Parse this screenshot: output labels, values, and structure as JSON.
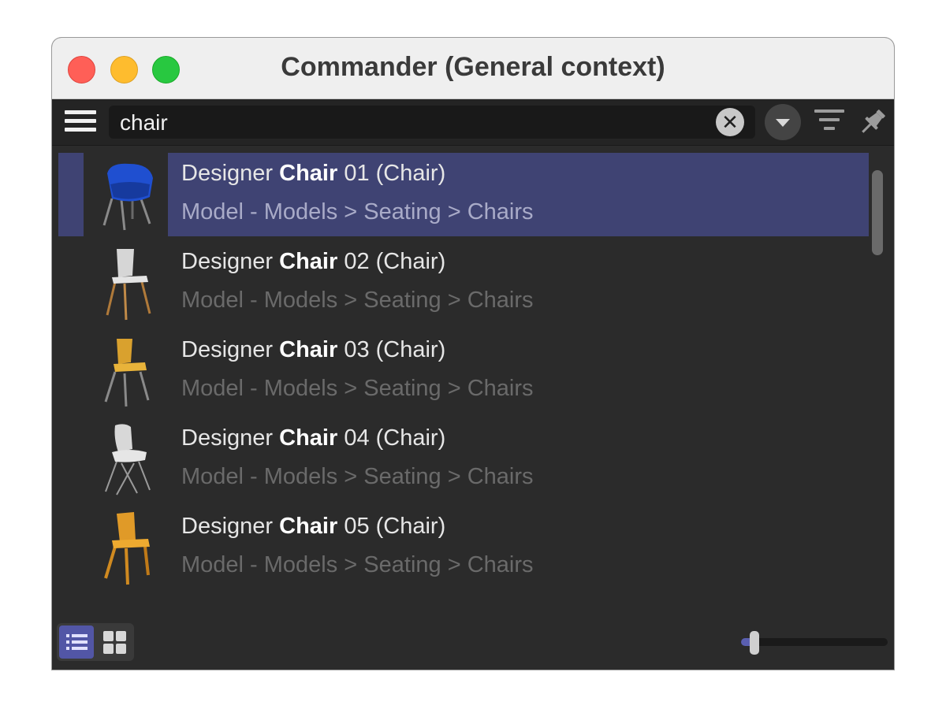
{
  "window": {
    "title": "Commander (General context)"
  },
  "toolbar": {
    "search_value": "chair",
    "menu_icon": "hamburger-icon",
    "clear_icon": "clear-x-icon",
    "dropdown_icon": "chevron-down-icon",
    "filter_icon": "filter-icon",
    "pin_icon": "pin-icon"
  },
  "results": [
    {
      "prefix": "Designer ",
      "match": "Chair",
      "suffix": " 01 (Chair)",
      "path": "Model - Models > Seating > Chairs",
      "selected": true
    },
    {
      "prefix": "Designer ",
      "match": "Chair",
      "suffix": " 02 (Chair)",
      "path": "Model - Models > Seating > Chairs",
      "selected": false
    },
    {
      "prefix": "Designer ",
      "match": "Chair",
      "suffix": " 03 (Chair)",
      "path": "Model - Models > Seating > Chairs",
      "selected": false
    },
    {
      "prefix": "Designer ",
      "match": "Chair",
      "suffix": " 04 (Chair)",
      "path": "Model - Models > Seating > Chairs",
      "selected": false
    },
    {
      "prefix": "Designer ",
      "match": "Chair",
      "suffix": " 05 (Chair)",
      "path": "Model - Models > Seating > Chairs",
      "selected": false
    }
  ],
  "footer": {
    "list_view_icon": "list-view-icon",
    "grid_view_icon": "grid-view-icon",
    "active_view": "list",
    "thumbnail_size_level": 0.1
  },
  "colors": {
    "selection": "#3f4373",
    "accent": "#5256a6"
  }
}
